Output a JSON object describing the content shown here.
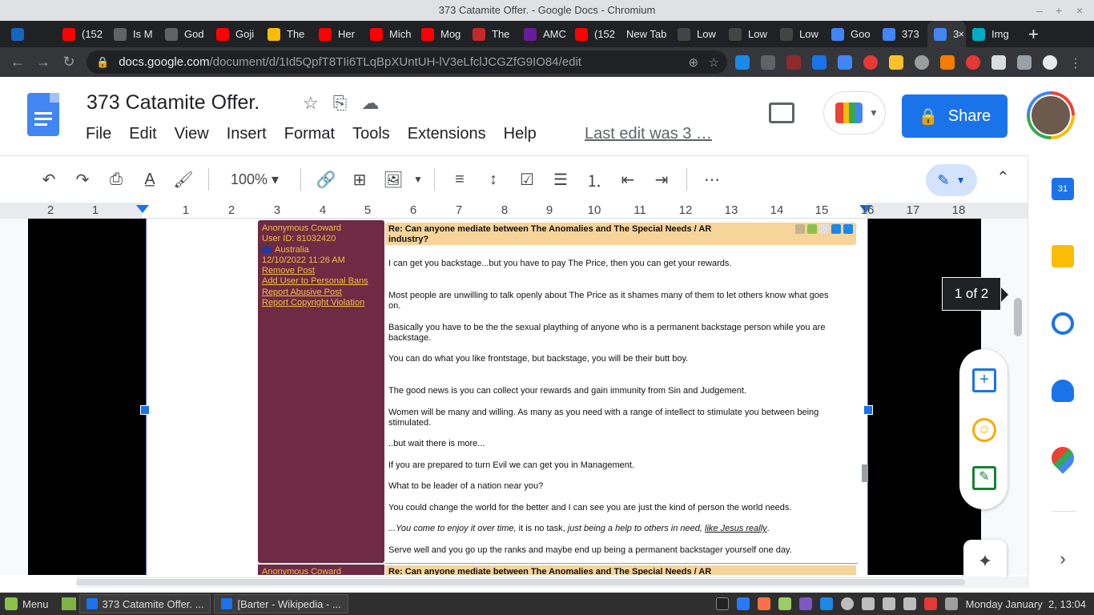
{
  "window": {
    "title": "373 Catamite Offer. - Google Docs - Chromium",
    "minimize": "–",
    "maximize": "+",
    "close": "×"
  },
  "tabs": [
    {
      "label": "",
      "color": "#1565c0"
    },
    {
      "label": "(152",
      "color": "#ff0000"
    },
    {
      "label": "Is M",
      "color": "#5f6368"
    },
    {
      "label": "God",
      "color": "#5f6368"
    },
    {
      "label": "Goji",
      "color": "#ff0000"
    },
    {
      "label": "The",
      "color": "#fbbc04"
    },
    {
      "label": "Her",
      "color": "#ff0000"
    },
    {
      "label": "Mich",
      "color": "#ff0000"
    },
    {
      "label": "Mog",
      "color": "#ff0000"
    },
    {
      "label": "The",
      "color": "#c62828"
    },
    {
      "label": "AMC",
      "color": "#6a1b9a"
    },
    {
      "label": "(152",
      "color": "#ff0000"
    },
    {
      "label": "New Tab",
      "color": ""
    },
    {
      "label": "Low",
      "color": "#444"
    },
    {
      "label": "Low",
      "color": "#444"
    },
    {
      "label": "Low",
      "color": "#444"
    },
    {
      "label": "Goo",
      "color": "#4285f4"
    },
    {
      "label": "373",
      "color": "#4285f4"
    },
    {
      "label": "3",
      "color": "#4285f4",
      "active": true
    },
    {
      "label": "Img",
      "color": "#00acc1"
    }
  ],
  "new_tab_icon": "+",
  "address": {
    "host": "docs.google.com",
    "path": "/document/d/1Id5QpfT8TIi6TLqBpXUntUH-lV3eLfclJCGZfG9IO84/edit"
  },
  "doc": {
    "title": "373 Catamite Offer.",
    "menu": [
      "File",
      "Edit",
      "View",
      "Insert",
      "Format",
      "Tools",
      "Extensions",
      "Help"
    ],
    "last_edit": "Last edit was 3 …",
    "share_label": "Share",
    "zoom": "100%"
  },
  "ruler": {
    "numbers": [
      "2",
      "1",
      "1",
      "2",
      "3",
      "4",
      "5",
      "6",
      "7",
      "8",
      "9",
      "10",
      "11",
      "12",
      "13",
      "14",
      "15",
      "16",
      "17",
      "18"
    ]
  },
  "post": {
    "author": "Anonymous Coward",
    "user_id": "User ID: 81032420",
    "country": "Australia",
    "date": "12/10/2022 11:26 AM",
    "links": [
      "Remove Post",
      "Add User to Personal Bans",
      "Report Abusive Post",
      "Report Copyright Violation"
    ],
    "subject": "Re: Can anyone mediate between The Anomalies and The Special Needs / AR industry?",
    "body": {
      "p1": "I can get you backstage...but you have to pay The Price, then you can get your rewards.",
      "p2": "Most people are unwilling to talk openly about The Price as it shames many of them to let others know what goes on.",
      "p3": "Basically you have to be the the sexual plaything of anyone who is a permanent backstage person while you are backstage.",
      "p4": "You can do what you like frontstage, but backstage, you will be their butt boy.",
      "p5": "The good news is you can collect your rewards and gain immunity from Sin and Judgement.",
      "p6": "Women will be many and willing. As many as you need with a range of intellect to stimulate you between being stimulated.",
      "p7": "..but wait there is more...",
      "p8": "If you are prepared to turn Evil we can get you in Management.",
      "p9": "What to be leader of a nation near you?",
      "p10": "You could change the world for the better and I can see you are just the kind of person the world needs.",
      "p11a": "...You come to enjoy it over time,",
      "p11b": " it is no task, ",
      "p11c": "just being a help to others in need,",
      "p11d": " ",
      "p11e": "like Jesus really",
      "p11f": ".",
      "p12": "Serve well and you go up the ranks and maybe end up being a permanent backstager yourself one day."
    }
  },
  "post2": {
    "author": "Anonymous Coward",
    "subject": "Re: Can anyone mediate between The Anomalies and The Special Needs / AR"
  },
  "page_indicator": "1 of 2",
  "taskbar": {
    "menu_label": "Menu",
    "windows": [
      "373 Catamite Offer. ...",
      "[Barter - Wikipedia - ..."
    ],
    "clock": "Monday January  2, 13:04"
  },
  "icons": {
    "back": "back-arrow-icon",
    "forward": "forward-arrow-icon",
    "reload": "reload-icon"
  },
  "colors": {
    "share_blue": "#1a73e8",
    "post_sidebar": "#6f2a44",
    "post_header": "#f6d49a"
  }
}
